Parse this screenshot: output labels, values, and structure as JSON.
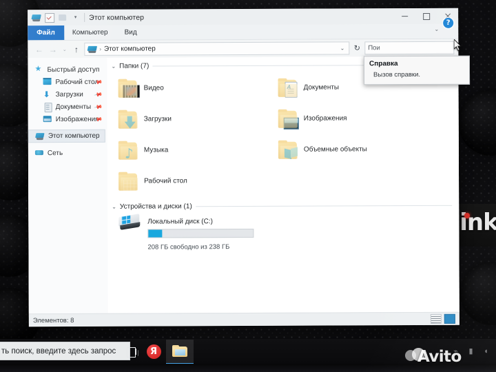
{
  "window": {
    "title": "Этот компьютер",
    "quick_access_icons": [
      "this-pc-icon",
      "properties-icon",
      "new-folder-icon",
      "customize-caret-icon"
    ],
    "controls": {
      "minimize": "—",
      "maximize": "□",
      "close": "×"
    }
  },
  "ribbon": {
    "tabs": [
      {
        "label": "Файл",
        "selected": true
      },
      {
        "label": "Компьютер",
        "selected": false
      },
      {
        "label": "Вид",
        "selected": false
      }
    ],
    "help_icon": "?",
    "collapse_caret": "⌄"
  },
  "address_bar": {
    "back": "←",
    "forward": "→",
    "recent": "⌄",
    "up": "↑",
    "breadcrumb_icon": "this-pc-icon",
    "breadcrumb_sep": "›",
    "breadcrumb": "Этот компьютер",
    "dropdown_caret": "⌄",
    "refresh": "↻",
    "search_text": "Пои"
  },
  "sidebar": {
    "items": [
      {
        "label": "Быстрый доступ",
        "icon": "star-icon",
        "indent": false,
        "pinned": false,
        "selected": false
      },
      {
        "label": "Рабочий стол",
        "icon": "desktop-icon",
        "indent": true,
        "pinned": true,
        "selected": false
      },
      {
        "label": "Загрузки",
        "icon": "downloads-icon",
        "indent": true,
        "pinned": true,
        "selected": false
      },
      {
        "label": "Документы",
        "icon": "documents-icon",
        "indent": true,
        "pinned": true,
        "selected": false
      },
      {
        "label": "Изображения",
        "icon": "pictures-icon",
        "indent": true,
        "pinned": true,
        "selected": false
      },
      {
        "label": "Этот компьютер",
        "icon": "this-pc-icon",
        "indent": false,
        "pinned": false,
        "selected": true
      },
      {
        "label": "Сеть",
        "icon": "network-icon",
        "indent": false,
        "pinned": false,
        "selected": false
      }
    ]
  },
  "content": {
    "folders_group": {
      "title": "Папки (7)",
      "chevron": "⌄",
      "items": [
        {
          "label": "Видео",
          "icon": "video-folder-icon"
        },
        {
          "label": "Документы",
          "icon": "documents-folder-icon"
        },
        {
          "label": "Загрузки",
          "icon": "downloads-folder-icon"
        },
        {
          "label": "Изображения",
          "icon": "pictures-folder-icon"
        },
        {
          "label": "Музыка",
          "icon": "music-folder-icon"
        },
        {
          "label": "Объемные объекты",
          "icon": "3d-objects-folder-icon"
        },
        {
          "label": "Рабочий стол",
          "icon": "desktop-folder-icon"
        }
      ]
    },
    "devices_group": {
      "title": "Устройства и диски (1)",
      "chevron": "⌄",
      "drive": {
        "name": "Локальный диск (C:)",
        "icon": "hard-disk-icon",
        "free_space_text": "208 ГБ свободно из 238 ГБ",
        "used_percent": 13,
        "bar_color": "#18a4dd"
      }
    }
  },
  "status_bar": {
    "items_count_text": "Элементов: 8",
    "view_details_icon": "details-view-icon",
    "view_icons_icon": "large-icons-view-icon"
  },
  "tooltip": {
    "title": "Справка",
    "body": "Вызов справки."
  },
  "taskbar": {
    "search_placeholder": "ть поиск, введите здесь запрос",
    "task_view_icon": "task-view-icon",
    "yandex_label": "Я",
    "explorer_icon": "file-explorer-icon",
    "tray_icons": [
      "bluetooth-icon",
      "network-icon",
      "volume-icon"
    ]
  },
  "background": {
    "laptop_brand": "hink",
    "watermark": "Avito"
  }
}
